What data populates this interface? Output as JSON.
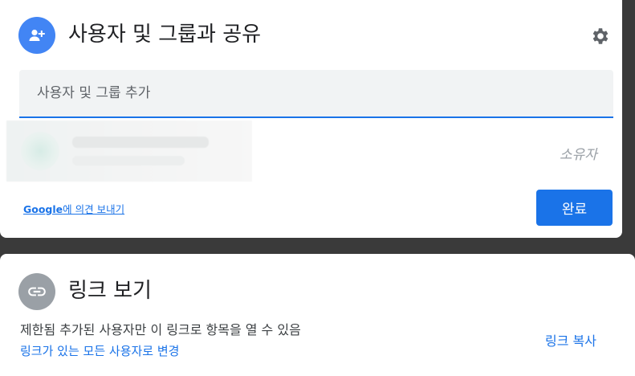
{
  "colors": {
    "accent": "#1a73e8",
    "share_icon_bg": "#4285f4",
    "link_icon_bg": "#9aa0a6",
    "backdrop": "#3a3a3a"
  },
  "share_panel": {
    "icon": "person-add-icon",
    "title": "사용자 및 그룹과 공유",
    "settings_icon": "gear-icon",
    "search": {
      "placeholder": "사용자 및 그룹 추가",
      "value": ""
    },
    "owner": {
      "role": "소유자"
    },
    "feedback": {
      "brand": "Google",
      "text": "에 의견 보내기"
    },
    "done_label": "완료"
  },
  "link_panel": {
    "icon": "link-icon",
    "title": "링크 보기",
    "restriction_text": "제한됨 추가된 사용자만 이 링크로 항목을 열 수 있음",
    "change_link": "링크가 있는 모든 사용자로 변경",
    "copy_link": "링크 복사"
  }
}
